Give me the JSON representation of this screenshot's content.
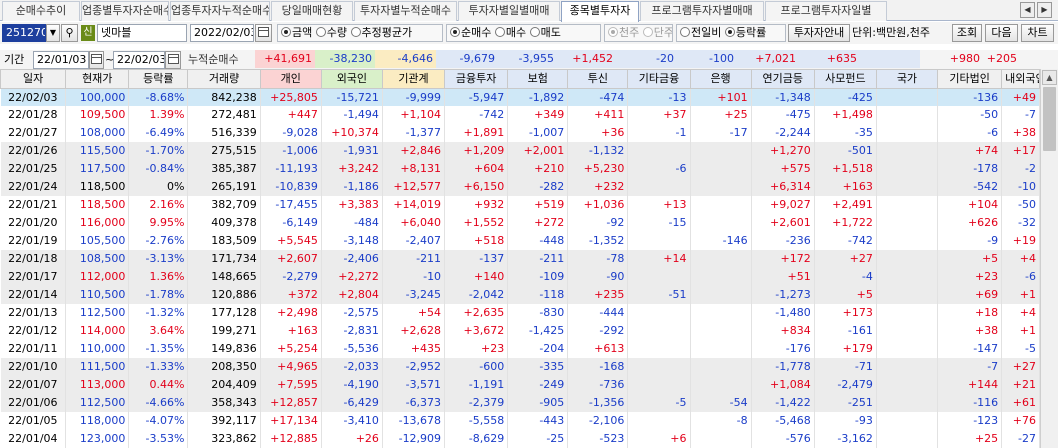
{
  "tabs": [
    "순매수추이",
    "업종별투자자순매수",
    "업종투자자누적순매수",
    "당일매매현황",
    "투자자별누적순매수",
    "투자자별일별매매",
    "종목별투자자",
    "프로그램투자자별매매",
    "프로그램투자자일별"
  ],
  "active_tab": "종목별투자자",
  "toolbar": {
    "code": "251270",
    "credit_badge": "신",
    "name": "넷마블",
    "date": "2022/02/03",
    "unit_group": [
      "금액",
      "수량",
      "추정평균가"
    ],
    "unit_selected": "금액",
    "trade_group": [
      "순매수",
      "매수",
      "매도"
    ],
    "trade_selected": "순매수",
    "share_group": [
      "천주",
      "단주"
    ],
    "share_selected": "천주",
    "change_group": [
      "전일비",
      "등락률"
    ],
    "change_selected": "등락률",
    "guide_btn": "투자자안내",
    "unit_text": "단위:백만원,천주",
    "query_btn": "조회",
    "next_btn": "다음",
    "chart_btn": "차트"
  },
  "period": {
    "label": "기간",
    "from": "22/01/03",
    "tilde": "~",
    "to": "22/02/03",
    "cum_label": "누적순매수"
  },
  "totals": [
    "+41,691",
    "-38,230",
    "-4,646",
    "-9,679",
    "-3,955",
    "+1,452",
    "-20",
    "-100",
    "+7,021",
    "+635",
    "",
    "+980",
    "+205"
  ],
  "columns": [
    "일자",
    "현재가",
    "등락률",
    "거래량",
    "개인",
    "외국인",
    "기관계",
    "금융투자",
    "보험",
    "투신",
    "기타금융",
    "은행",
    "연기금등",
    "사모펀드",
    "국가",
    "기타법인",
    "내외국인"
  ],
  "rows": [
    [
      "22/02/03",
      "100,000",
      "-8.68%",
      "842,238",
      "+25,805",
      "-15,721",
      "-9,999",
      "-5,947",
      "-1,892",
      "-474",
      "-13",
      "+101",
      "-1,348",
      "-425",
      "",
      "-136",
      "+49"
    ],
    [
      "22/01/28",
      "109,500",
      "1.39%",
      "272,481",
      "+447",
      "-1,494",
      "+1,104",
      "-742",
      "+349",
      "+411",
      "+37",
      "+25",
      "-475",
      "+1,498",
      "",
      "-50",
      "-7"
    ],
    [
      "22/01/27",
      "108,000",
      "-6.49%",
      "516,339",
      "-9,028",
      "+10,374",
      "-1,377",
      "+1,891",
      "-1,007",
      "+36",
      "-1",
      "-17",
      "-2,244",
      "-35",
      "",
      "-6",
      "+38"
    ],
    [
      "22/01/26",
      "115,500",
      "-1.70%",
      "275,515",
      "-1,006",
      "-1,931",
      "+2,846",
      "+1,209",
      "+2,001",
      "-1,132",
      "",
      "",
      "+1,270",
      "-501",
      "",
      "+74",
      "+17"
    ],
    [
      "22/01/25",
      "117,500",
      "-0.84%",
      "385,387",
      "-11,193",
      "+3,242",
      "+8,131",
      "+604",
      "+210",
      "+5,230",
      "-6",
      "",
      "+575",
      "+1,518",
      "",
      "-178",
      "-2"
    ],
    [
      "22/01/24",
      "118,500",
      "0%",
      "265,191",
      "-10,839",
      "-1,186",
      "+12,577",
      "+6,150",
      "-282",
      "+232",
      "",
      "",
      "+6,314",
      "+163",
      "",
      "-542",
      "-10"
    ],
    [
      "22/01/21",
      "118,500",
      "2.16%",
      "382,709",
      "-17,455",
      "+3,383",
      "+14,019",
      "+932",
      "+519",
      "+1,036",
      "+13",
      "",
      "+9,027",
      "+2,491",
      "",
      "+104",
      "-50"
    ],
    [
      "22/01/20",
      "116,000",
      "9.95%",
      "409,378",
      "-6,149",
      "-484",
      "+6,040",
      "+1,552",
      "+272",
      "-92",
      "-15",
      "",
      "+2,601",
      "+1,722",
      "",
      "+626",
      "-32"
    ],
    [
      "22/01/19",
      "105,500",
      "-2.76%",
      "183,509",
      "+5,545",
      "-3,148",
      "-2,407",
      "+518",
      "-448",
      "-1,352",
      "",
      "-146",
      "-236",
      "-742",
      "",
      "-9",
      "+19"
    ],
    [
      "22/01/18",
      "108,500",
      "-3.13%",
      "171,734",
      "+2,607",
      "-2,406",
      "-211",
      "-137",
      "-211",
      "-78",
      "+14",
      "",
      "+172",
      "+27",
      "",
      "+5",
      "+4"
    ],
    [
      "22/01/17",
      "112,000",
      "1.36%",
      "148,665",
      "-2,279",
      "+2,272",
      "-10",
      "+140",
      "-109",
      "-90",
      "",
      "",
      "+51",
      "-4",
      "",
      "+23",
      "-6"
    ],
    [
      "22/01/14",
      "110,500",
      "-1.78%",
      "120,886",
      "+372",
      "+2,804",
      "-3,245",
      "-2,042",
      "-118",
      "+235",
      "-51",
      "",
      "-1,273",
      "+5",
      "",
      "+69",
      "+1"
    ],
    [
      "22/01/13",
      "112,500",
      "-1.32%",
      "177,128",
      "+2,498",
      "-2,575",
      "+54",
      "+2,635",
      "-830",
      "-444",
      "",
      "",
      "-1,480",
      "+173",
      "",
      "+18",
      "+4"
    ],
    [
      "22/01/12",
      "114,000",
      "3.64%",
      "199,271",
      "+163",
      "-2,831",
      "+2,628",
      "+3,672",
      "-1,425",
      "-292",
      "",
      "",
      "+834",
      "-161",
      "",
      "+38",
      "+1"
    ],
    [
      "22/01/11",
      "110,000",
      "-1.35%",
      "149,836",
      "+5,254",
      "-5,536",
      "+435",
      "+23",
      "-204",
      "+613",
      "",
      "",
      "-176",
      "+179",
      "",
      "-147",
      "-5"
    ],
    [
      "22/01/10",
      "111,500",
      "-1.33%",
      "208,350",
      "+4,965",
      "-2,033",
      "-2,952",
      "-600",
      "-335",
      "-168",
      "",
      "",
      "-1,778",
      "-71",
      "",
      "-7",
      "+27"
    ],
    [
      "22/01/07",
      "113,000",
      "0.44%",
      "204,409",
      "+7,595",
      "-4,190",
      "-3,571",
      "-1,191",
      "-249",
      "-736",
      "",
      "",
      "+1,084",
      "-2,479",
      "",
      "+144",
      "+21"
    ],
    [
      "22/01/06",
      "112,500",
      "-4.66%",
      "358,343",
      "+12,857",
      "-6,429",
      "-6,373",
      "-2,379",
      "-905",
      "-1,356",
      "-5",
      "-54",
      "-1,422",
      "-251",
      "",
      "-116",
      "+61"
    ],
    [
      "22/01/05",
      "118,000",
      "-4.07%",
      "392,117",
      "+17,134",
      "-3,410",
      "-13,678",
      "-5,558",
      "-443",
      "-2,106",
      "",
      "-8",
      "-5,468",
      "-93",
      "",
      "-123",
      "+76"
    ],
    [
      "22/01/04",
      "123,000",
      "-3.53%",
      "323,862",
      "+12,885",
      "+26",
      "-12,909",
      "-8,629",
      "-25",
      "-523",
      "+6",
      "",
      "-576",
      "-3,162",
      "",
      "+25",
      "-27"
    ]
  ],
  "colors": {
    "positive": "#e2001a",
    "negative": "#1a3cc8",
    "selected_row": "#cfe8f7",
    "shaded_row": "#ececec",
    "person_header": "#fbd3d3",
    "foreign_header": "#d9f0c9",
    "inst_header": "#fbecc2",
    "sub_inst_header": "#dfe8f6"
  }
}
